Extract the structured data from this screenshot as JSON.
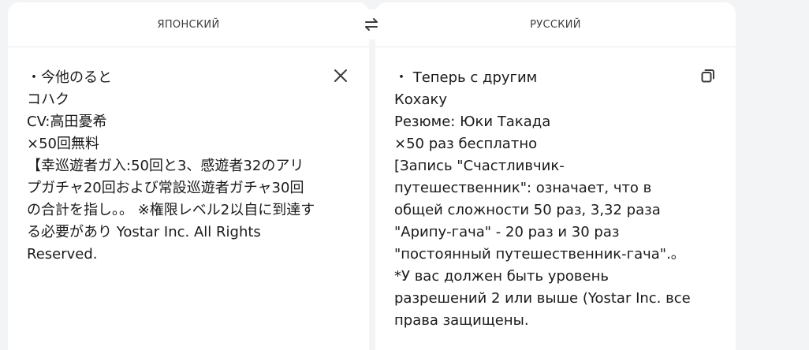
{
  "source": {
    "language": "ЯПОНСКИЙ",
    "text": "・今他のると\nコハク\nCV:高田憂希\n×50回無料\n【幸巡遊者ガ入:50回と3、感遊者32のアリプガチャ20回および常設巡遊者ガチャ30回の合計を指し。。 ※権限レベル2以自に到達する必要があり Yostar Inc. All Rights Reserved."
  },
  "target": {
    "language": "РУССКИЙ",
    "text": "・ Теперь с другим\nКохаку\nРезюме: Юки Такада\n×50 раз бесплатно\n[Запись \"Счастливчик-путешественник\": означает, что в общей сложности 50 раз, 3,32 раза \"Арипу-гача\" - 20 раз и 30 раз \"постоянный путешественник-гача\".。\n*У вас должен быть уровень разрешений 2 или выше (Yostar Inc. все права защищены."
  },
  "icons": {
    "swap": "swap-arrows-icon",
    "clear": "close-icon",
    "copy": "copy-icon"
  },
  "colors": {
    "background": "#f3f4f6",
    "panel": "#ffffff",
    "text": "#1a1a1a",
    "icon": "#3c3c3c"
  }
}
